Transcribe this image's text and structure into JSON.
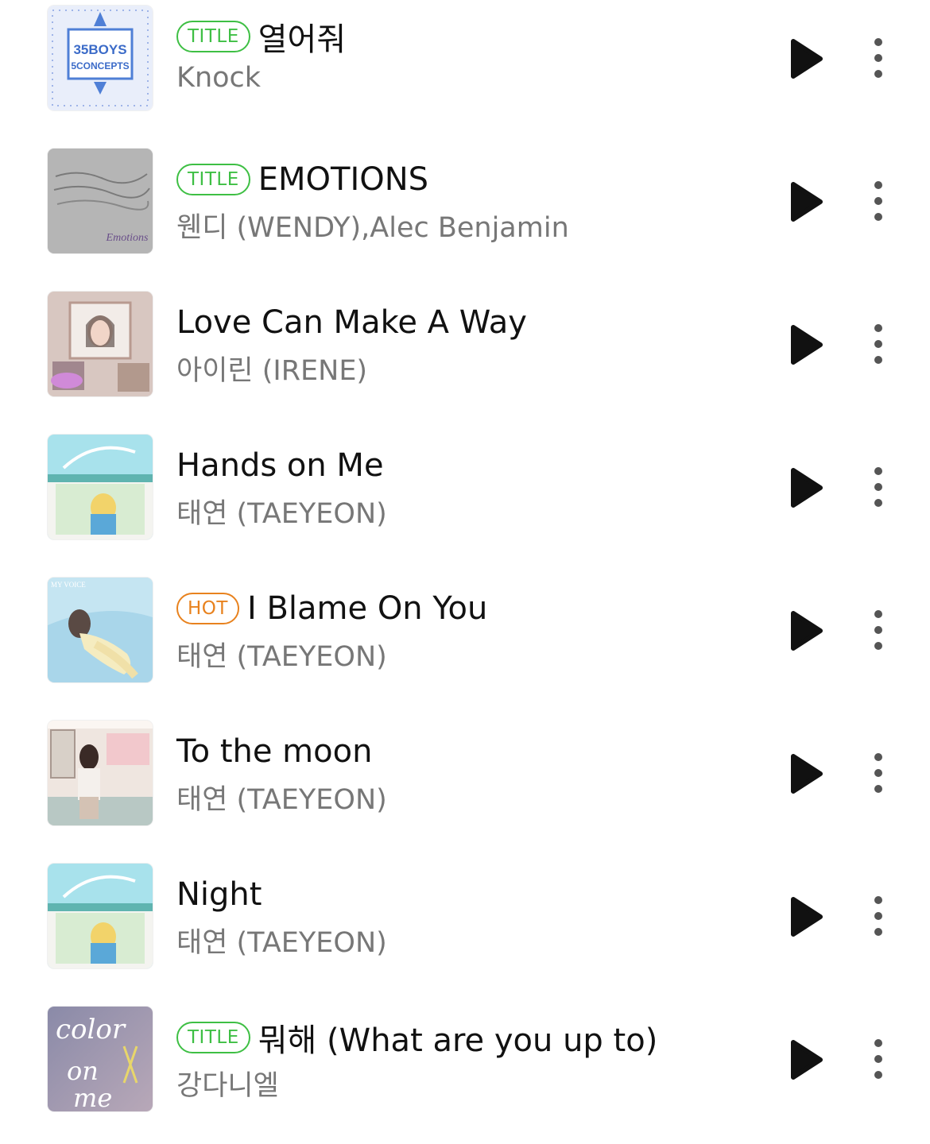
{
  "badge_labels": {
    "title": "TITLE",
    "hot": "HOT"
  },
  "colors": {
    "title_badge": "#3ebf44",
    "hot_badge": "#e8821e",
    "song_title": "#111111",
    "artist": "#777777",
    "icon": "#111111",
    "more_icon": "#555555"
  },
  "icons": {
    "play": "play-icon",
    "more": "more-vertical-icon"
  },
  "tracks": [
    {
      "badge": "TITLE",
      "title": "열어줘",
      "artist": "Knock",
      "album_art": "produce-101-35-boys-5-concepts-cover",
      "album_art_text": [
        "35BOYS",
        "5CONCEPTS"
      ]
    },
    {
      "badge": "TITLE",
      "title": "EMOTIONS",
      "artist": "웬디 (WENDY),Alec Benjamin",
      "album_art": "emotions-handwritten-cover",
      "album_art_text": [
        "Emotions"
      ]
    },
    {
      "badge": "",
      "title": "Love Can Make A Way",
      "artist": "아이린 (IRENE)",
      "album_art": "irene-collage-cover"
    },
    {
      "badge": "",
      "title": "Hands on Me",
      "artist": "태연 (TAEYEON)",
      "album_art": "taeyeon-sky-cover"
    },
    {
      "badge": "HOT",
      "title": "I Blame On You",
      "artist": "태연 (TAEYEON)",
      "album_art": "taeyeon-my-voice-cover",
      "album_art_text": [
        "MY VOICE"
      ]
    },
    {
      "badge": "",
      "title": "To the moon",
      "artist": "태연 (TAEYEON)",
      "album_art": "taeyeon-what-do-i-call-you-cover"
    },
    {
      "badge": "",
      "title": "Night",
      "artist": "태연 (TAEYEON)",
      "album_art": "taeyeon-sky-cover"
    },
    {
      "badge": "TITLE",
      "title": "뭐해 (What are you up to)",
      "artist": "강다니엘",
      "album_art": "kang-daniel-color-on-me-cover",
      "album_art_text": [
        "color",
        "on",
        "me"
      ]
    }
  ]
}
